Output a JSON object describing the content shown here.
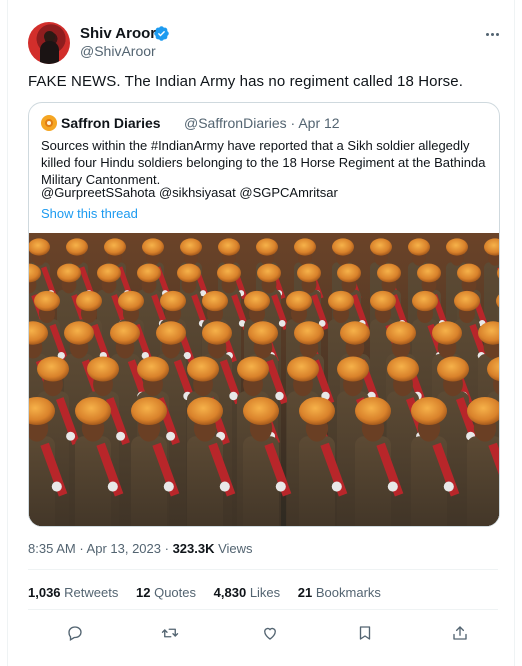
{
  "author": {
    "name": "Shiv Aroor",
    "handle": "@ShivAroor",
    "verified": true
  },
  "tweet": {
    "text": "FAKE NEWS. The Indian Army has no regiment called 18 Horse."
  },
  "quoted": {
    "name": "Saffron Diaries",
    "handle": "@SaffronDiaries",
    "date": "Apr 12",
    "body": "Sources within the #IndianArmy have reported that a Sikh soldier allegedly killed four Hindu soldiers belonging to the 18 Horse Regiment at the Bathinda Military Cantonment.",
    "mentions": "@GurpreetSSahota @sikhsiyasat @SGPCAmritsar",
    "show_thread": "Show this thread"
  },
  "meta": {
    "time": "8:35 AM",
    "date": "Apr 13, 2023",
    "views_count": "323.3K",
    "views_label": "Views"
  },
  "stats": {
    "retweets": {
      "count": "1,036",
      "label": "Retweets"
    },
    "quotes": {
      "count": "12",
      "label": "Quotes"
    },
    "likes": {
      "count": "4,830",
      "label": "Likes"
    },
    "bookmarks": {
      "count": "21",
      "label": "Bookmarks"
    }
  },
  "icons": [
    "verified-badge-icon",
    "more-icon",
    "reply-icon",
    "retweet-icon",
    "like-icon",
    "bookmark-icon",
    "share-icon"
  ],
  "colors": {
    "accent": "#1d9bf0",
    "text": "#0f1419",
    "muted": "#536471",
    "border": "#cfd9de"
  }
}
